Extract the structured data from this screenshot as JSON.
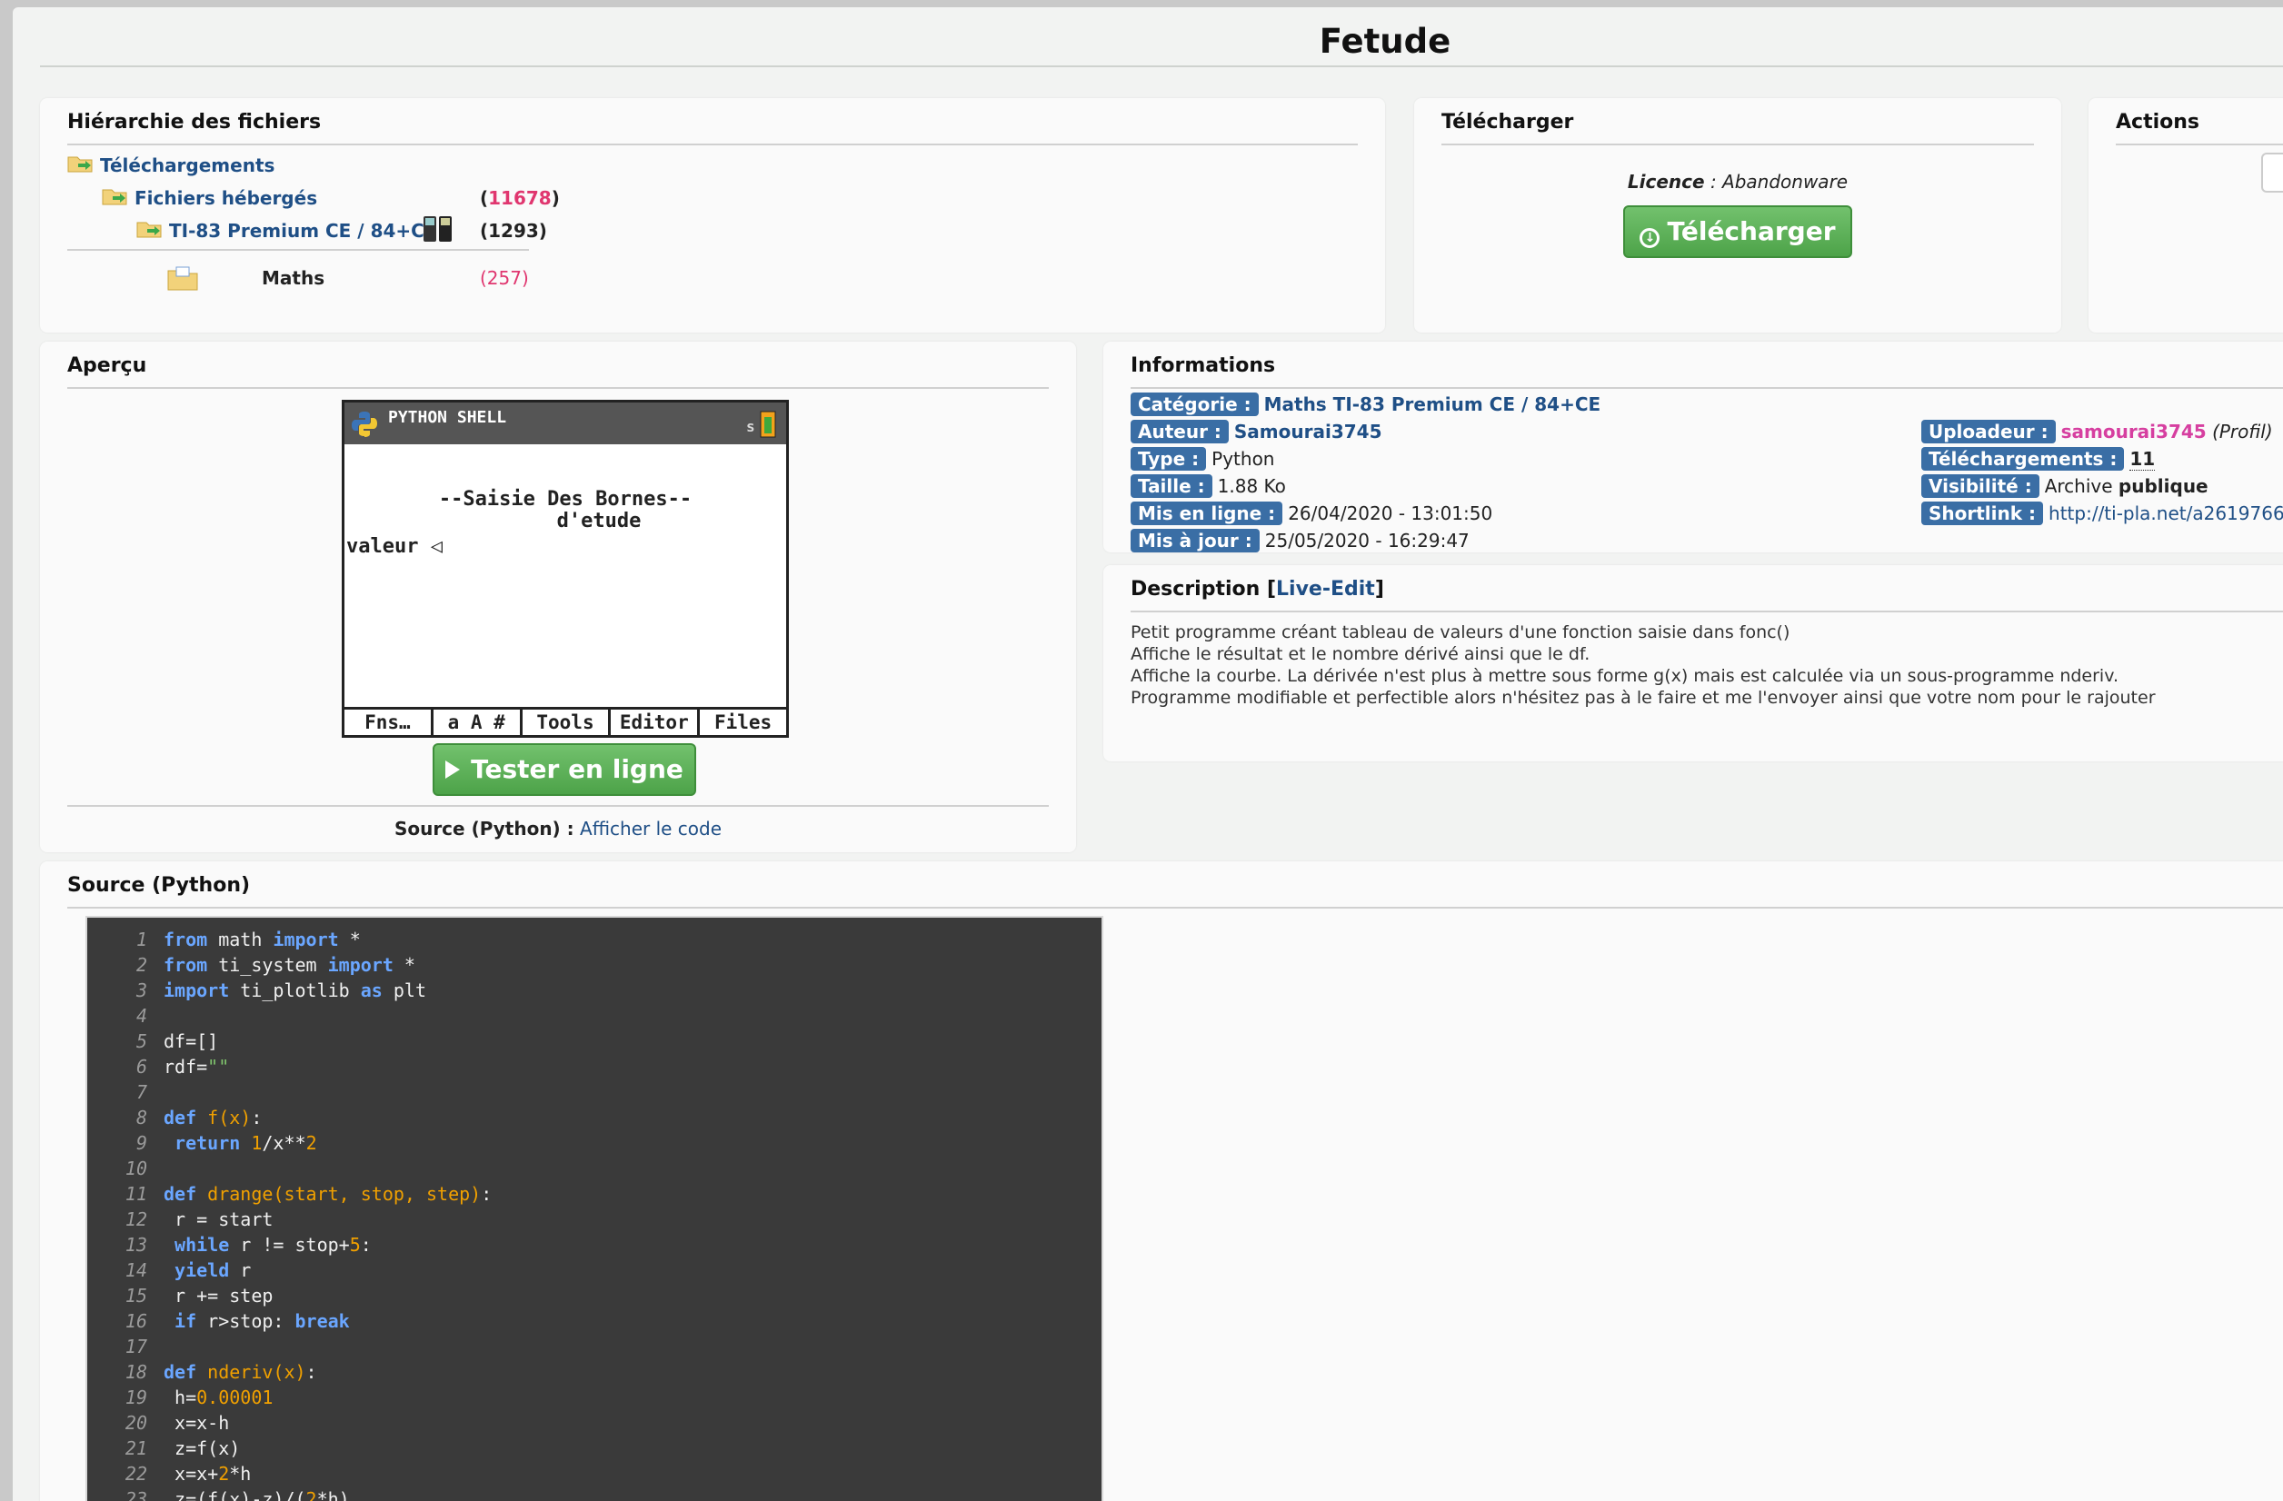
{
  "page_title": "Fetude",
  "hierarchy": {
    "title": "Hiérarchie des fichiers",
    "items": [
      {
        "label": "Téléchargements",
        "count": ""
      },
      {
        "label": "Fichiers hébergés",
        "count_open": "(",
        "count": "11678",
        "count_close": ")"
      },
      {
        "label": "TI-83 Premium CE / 84+CE",
        "count": "(1293)"
      }
    ],
    "sub": {
      "label": "Maths",
      "count": "(257)"
    }
  },
  "download": {
    "title": "Télécharger",
    "licence_label": "Licence",
    "licence_value": ": Abandonware",
    "button_label": "Télécharger"
  },
  "actions": {
    "title": "Actions"
  },
  "preview": {
    "title": "Aperçu",
    "calc": {
      "header": "PYTHON SHELL",
      "line1": "--Saisie Des Bornes--",
      "line2": "d'etude",
      "line3": "valeur ◁",
      "tabs": [
        "Fns…",
        "a A #",
        "Tools",
        "Editor",
        "Files"
      ]
    },
    "test_button": "Tester en ligne",
    "source_label": "Source (Python) :",
    "source_link": "Afficher le code"
  },
  "info": {
    "title": "Informations",
    "left": [
      {
        "label": "Catégorie :",
        "value": "Maths TI-83 Premium CE / 84+CE",
        "style": "link"
      },
      {
        "label": "Auteur :",
        "value": "Samourai3745",
        "style": "link"
      },
      {
        "label": "Type :",
        "value": "Python",
        "style": "plain"
      },
      {
        "label": "Taille :",
        "value": "1.88 Ko",
        "style": "plain"
      },
      {
        "label": "Mis en ligne :",
        "value": "26/04/2020 - 13:01:50",
        "style": "plain"
      },
      {
        "label": "Mis à jour :",
        "value": "25/05/2020 - 16:29:47",
        "style": "plain"
      }
    ],
    "right": {
      "uploader_label": "Uploadeur :",
      "uploader_value": "samourai3745",
      "uploader_profile": "(Profil)",
      "downloads_label": "Téléchargements :",
      "downloads_value": "11",
      "visibility_label": "Visibilité :",
      "visibility_value": "Archive",
      "visibility_bold": "publique",
      "shortlink_label": "Shortlink :",
      "shortlink_value": "http://ti-pla.net/a2619766"
    }
  },
  "description": {
    "title": "Description",
    "live_edit": "Live-Edit",
    "lines": [
      "Petit programme créant tableau de valeurs d'une fonction saisie dans fonc()",
      "Affiche le résultat et le nombre dérivé ainsi que le df.",
      "Affiche la courbe. La dérivée n'est plus à mettre sous forme g(x) mais est calculée via un sous-programme nderiv.",
      "Programme modifiable et perfectible alors n'hésitez pas à le faire et me l'envoyer ainsi que votre nom pour le rajouter"
    ]
  },
  "source": {
    "title": "Source (Python)",
    "lines": [
      {
        "n": "1",
        "html": "<span class='kw'>from</span> math <span class='kw'>import</span> *"
      },
      {
        "n": "2",
        "html": "<span class='kw'>from</span> ti_system <span class='kw'>import</span> *"
      },
      {
        "n": "3",
        "html": "<span class='kw'>import</span> ti_plotlib <span class='kw'>as</span> plt"
      },
      {
        "n": "4",
        "html": ""
      },
      {
        "n": "5",
        "html": "df=[]"
      },
      {
        "n": "6",
        "html": "rdf=<span class='str'>\"\"</span>"
      },
      {
        "n": "7",
        "html": ""
      },
      {
        "n": "8",
        "html": "<span class='kw'>def</span> <span class='fn'>f(x)</span>:"
      },
      {
        "n": "9",
        "html": " <span class='kw'>return</span> <span class='num'>1</span>/x**<span class='num'>2</span>"
      },
      {
        "n": "10",
        "html": ""
      },
      {
        "n": "11",
        "html": "<span class='kw'>def</span> <span class='fn'>drange(start, stop, step)</span>:"
      },
      {
        "n": "12",
        "html": " r = start"
      },
      {
        "n": "13",
        "html": " <span class='kw'>while</span> r != stop+<span class='num'>5</span>:"
      },
      {
        "n": "14",
        "html": " <span class='kw'>yield</span> r"
      },
      {
        "n": "15",
        "html": " r += step"
      },
      {
        "n": "16",
        "html": " <span class='kw'>if</span> r>stop: <span class='kw'>break</span>"
      },
      {
        "n": "17",
        "html": ""
      },
      {
        "n": "18",
        "html": "<span class='kw'>def</span> <span class='fn'>nderiv(x)</span>:"
      },
      {
        "n": "19",
        "html": " h=<span class='num'>0.00001</span>"
      },
      {
        "n": "20",
        "html": " x=x-h"
      },
      {
        "n": "21",
        "html": " z=f(x)"
      },
      {
        "n": "22",
        "html": " x=x+<span class='num'>2</span>*h"
      },
      {
        "n": "23",
        "html": " z=(f(x)-z)/(<span class='num'>2</span>*h)"
      }
    ]
  }
}
